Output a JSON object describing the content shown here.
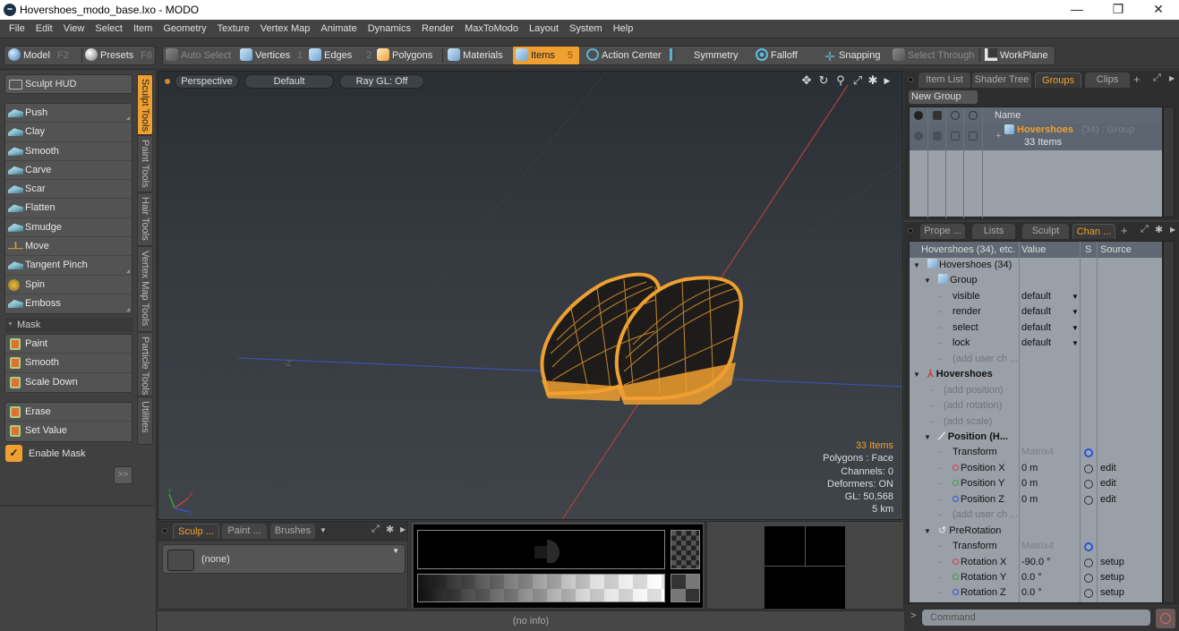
{
  "window": {
    "title": "Hovershoes_modo_base.lxo - MODO",
    "controls": {
      "minimize": "—",
      "maximize": "❐",
      "close": "✕"
    }
  },
  "menu": [
    "File",
    "Edit",
    "View",
    "Select",
    "Item",
    "Geometry",
    "Texture",
    "Vertex Map",
    "Animate",
    "Dynamics",
    "Render",
    "MaxToModo",
    "Layout",
    "System",
    "Help"
  ],
  "toolbar": {
    "model": {
      "label": "Model",
      "key": "F2"
    },
    "presets": {
      "label": "Presets",
      "key": "F6"
    },
    "auto_select": "Auto Select",
    "vertices": {
      "label": "Vertices",
      "key": "1"
    },
    "edges": {
      "label": "Edges",
      "key": "2"
    },
    "polygons": {
      "label": "Polygons"
    },
    "materials": {
      "label": "Materials"
    },
    "items": {
      "label": "Items",
      "key": "5",
      "active": true
    },
    "action_center": "Action Center",
    "symmetry": "Symmetry",
    "falloff": "Falloff",
    "snapping": "Snapping",
    "select_through": "Select Through",
    "workplane": "WorkPlane"
  },
  "left_panel": {
    "hud_label": "Sculpt HUD",
    "sculpt_tools": [
      "Push",
      "Clay",
      "Smooth",
      "Carve",
      "Scar",
      "Flatten",
      "Smudge",
      "Move",
      "Tangent Pinch",
      "Spin",
      "Emboss"
    ],
    "mask_header": "Mask",
    "mask_tools": [
      "Paint",
      "Smooth",
      "Scale Down"
    ],
    "mask_tools2": [
      "Erase",
      "Set Value"
    ],
    "enable_mask": {
      "label": "Enable Mask",
      "checked": true,
      "check": "✓"
    },
    "expand_label": ">>",
    "vertical_tabs": [
      "Sculpt Tools",
      "Paint Tools",
      "Hair Tools",
      "Vertex Map Tools",
      "Particle Tools",
      "Utilities"
    ],
    "active_tab": "Sculpt Tools"
  },
  "viewport": {
    "view": "Perspective",
    "shading": "Default",
    "raygl": "Ray GL: Off",
    "axis_label": "-Z",
    "info": {
      "items": "33 Items",
      "polygons": "Polygons : Face",
      "channels": "Channels: 0",
      "deformers": "Deformers: ON",
      "gl": "GL: 50,568",
      "scale": "5 km"
    },
    "icons": [
      "move-icon",
      "rotate-icon",
      "zoom-icon",
      "maximize-icon",
      "gear-icon",
      "play-icon"
    ],
    "model_color": "#f0a030"
  },
  "groups_panel": {
    "tabs": [
      "Item List",
      "Shader Tree",
      "Groups",
      "Clips"
    ],
    "active_tab": "Groups",
    "new_group": "New Group",
    "column_name": "Name",
    "group": {
      "name": "Hovershoes",
      "suffix": "(34) : Group",
      "count": "33 Items"
    }
  },
  "channels_panel": {
    "tabs": [
      "Prope ...",
      "Lists",
      "Sculpt",
      "Chan ..."
    ],
    "active_tab": "Chan ...",
    "headers": {
      "name": "Hovershoes (34), etc.",
      "value": "Value",
      "s": "S",
      "source": "Source"
    },
    "rows": [
      {
        "name": "Hovershoes (34)",
        "level": 0,
        "type": "item"
      },
      {
        "name": "Group",
        "level": 1,
        "type": "group"
      },
      {
        "name": "visible",
        "value": "default",
        "dropdown": true,
        "level": 2
      },
      {
        "name": "render",
        "value": "default",
        "dropdown": true,
        "level": 2
      },
      {
        "name": "select",
        "value": "default",
        "dropdown": true,
        "level": 2
      },
      {
        "name": "lock",
        "value": "default",
        "dropdown": true,
        "level": 2
      },
      {
        "name": "(add user ch ...",
        "level": 2,
        "dim": true
      },
      {
        "name": "Hovershoes",
        "level": 0,
        "bold": true,
        "type": "locator"
      },
      {
        "name": "(add position)",
        "level": 1,
        "dim": true
      },
      {
        "name": "(add rotation)",
        "level": 1,
        "dim": true
      },
      {
        "name": "(add scale)",
        "level": 1,
        "dim": true
      },
      {
        "name": "Position (H...",
        "level": 1,
        "bold": true,
        "type": "transform"
      },
      {
        "name": "Transform",
        "value": "Matrix4",
        "dimval": true,
        "s": "gear",
        "level": 2
      },
      {
        "name": "Position X",
        "value": "0 m",
        "s": "circle",
        "source": "edit",
        "axis": "x",
        "level": 2
      },
      {
        "name": "Position Y",
        "value": "0 m",
        "s": "circle",
        "source": "edit",
        "axis": "y",
        "level": 2
      },
      {
        "name": "Position Z",
        "value": "0 m",
        "s": "circle",
        "source": "edit",
        "axis": "z",
        "level": 2
      },
      {
        "name": "(add user ch ...",
        "level": 2,
        "dim": true
      },
      {
        "name": "PreRotation",
        "level": 1,
        "type": "rotation"
      },
      {
        "name": "Transform",
        "value": "Matrix4",
        "dimval": true,
        "s": "gear",
        "level": 2
      },
      {
        "name": "Rotation X",
        "value": "-90.0 °",
        "s": "circle",
        "source": "setup",
        "axis": "x",
        "level": 2
      },
      {
        "name": "Rotation Y",
        "value": "0.0 °",
        "s": "circle",
        "source": "setup",
        "axis": "y",
        "level": 2
      },
      {
        "name": "Rotation Z",
        "value": "0.0 °",
        "s": "circle",
        "source": "setup",
        "axis": "z",
        "level": 2
      }
    ]
  },
  "command": {
    "placeholder": "Command",
    "prompt": ">"
  },
  "brush_panel": {
    "tabs": [
      "Sculp ...",
      "Paint ...",
      "Brushes"
    ],
    "active_tab": "Sculp ...",
    "brush": "(none)"
  },
  "status": "(no info)",
  "colors": {
    "accent": "#f0a030",
    "axis_x": "#d04050",
    "axis_y": "#40a040",
    "axis_z": "#4050d0"
  }
}
